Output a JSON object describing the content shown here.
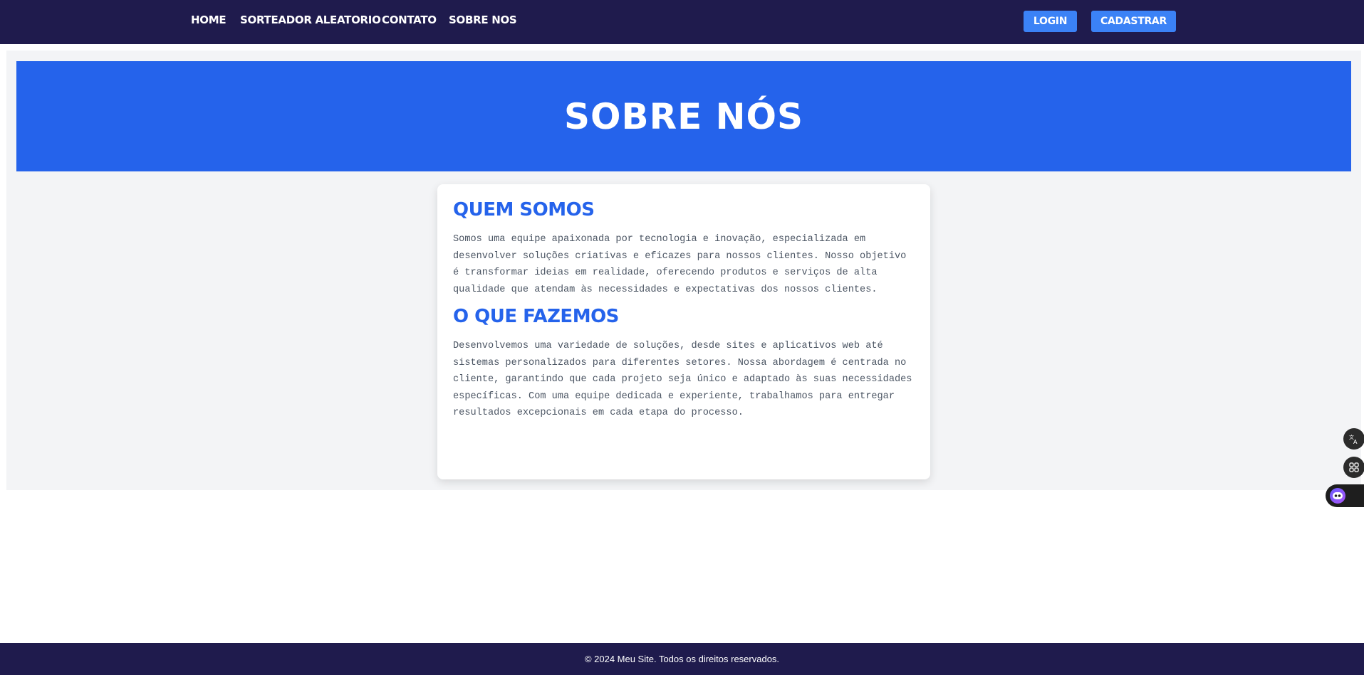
{
  "nav": {
    "links": [
      "HOME",
      "SORTEADOR ALEATORIO",
      "CONTATO",
      "SOBRE NOS"
    ],
    "login_label": "LOGIN",
    "register_label": "CADASTRAR"
  },
  "hero": {
    "title": "SOBRE NÓS"
  },
  "sections": [
    {
      "title": "QUEM SOMOS",
      "text": "Somos uma equipe apaixonada por tecnologia e inovação, especializada em desenvolver soluções criativas e eficazes para nossos clientes. Nosso objetivo é transformar ideias em realidade, oferecendo produtos e serviços de alta qualidade que atendam às necessidades e expectativas dos nossos clientes."
    },
    {
      "title": "O QUE FAZEMOS",
      "text": "Desenvolvemos uma variedade de soluções, desde sites e aplicativos web até sistemas personalizados para diferentes setores. Nossa abordagem é centrada no cliente, garantindo que cada projeto seja único e adaptado às suas necessidades específicas. Com uma equipe dedicada e experiente, trabalhamos para entregar resultados excepcionais em cada etapa do processo."
    }
  ],
  "footer": {
    "text": "© 2024 Meu Site. Todos os direitos reservados."
  },
  "side_tools": {
    "icons": [
      "translate-icon",
      "apps-grid-icon",
      "assistant-bot-icon"
    ]
  },
  "colors": {
    "navbar": "#1f1b4d",
    "hero": "#2563eb",
    "button": "#3b82f6",
    "heading": "#2563eb"
  }
}
